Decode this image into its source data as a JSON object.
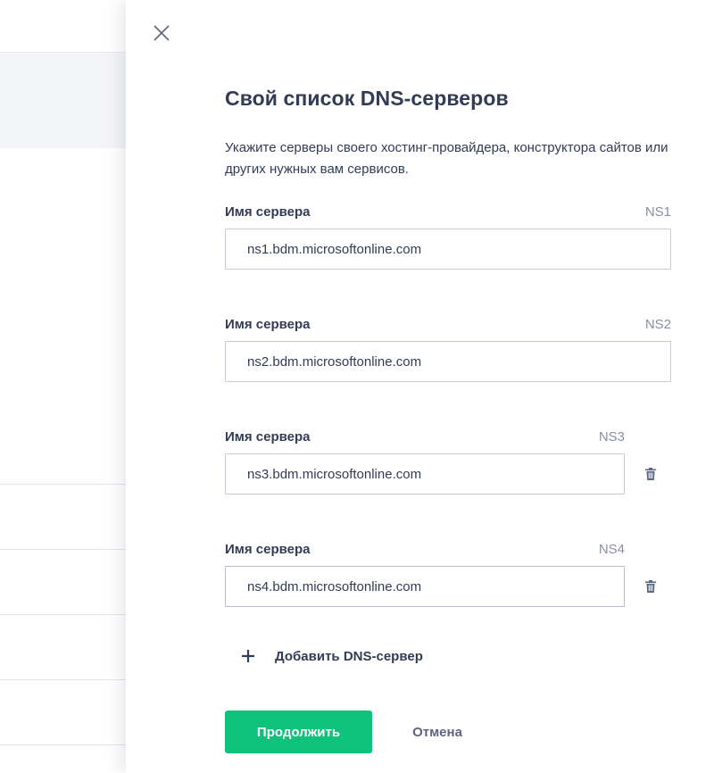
{
  "dialog": {
    "title": "Свой список DNS-серверов",
    "description": "Укажите серверы своего хостинг-провайдера, конструктора сайтов или других нужных вам сервисов.",
    "close_icon": "close-icon"
  },
  "servers": [
    {
      "label": "Имя сервера",
      "tag": "NS1",
      "value": "ns1.bdm.microsoftonline.com",
      "deletable": false
    },
    {
      "label": "Имя сервера",
      "tag": "NS2",
      "value": "ns2.bdm.microsoftonline.com",
      "deletable": false
    },
    {
      "label": "Имя сервера",
      "tag": "NS3",
      "value": "ns3.bdm.microsoftonline.com",
      "deletable": true
    },
    {
      "label": "Имя сервера",
      "tag": "NS4",
      "value": "ns4.bdm.microsoftonline.com",
      "deletable": true
    }
  ],
  "add_server": {
    "label": "Добавить DNS-сервер",
    "icon": "plus-icon"
  },
  "actions": {
    "continue_label": "Продолжить",
    "cancel_label": "Отмена"
  },
  "colors": {
    "accent": "#0ec27c",
    "text": "#333c55",
    "muted": "#8a90a2",
    "border": "#c9ccd6"
  }
}
